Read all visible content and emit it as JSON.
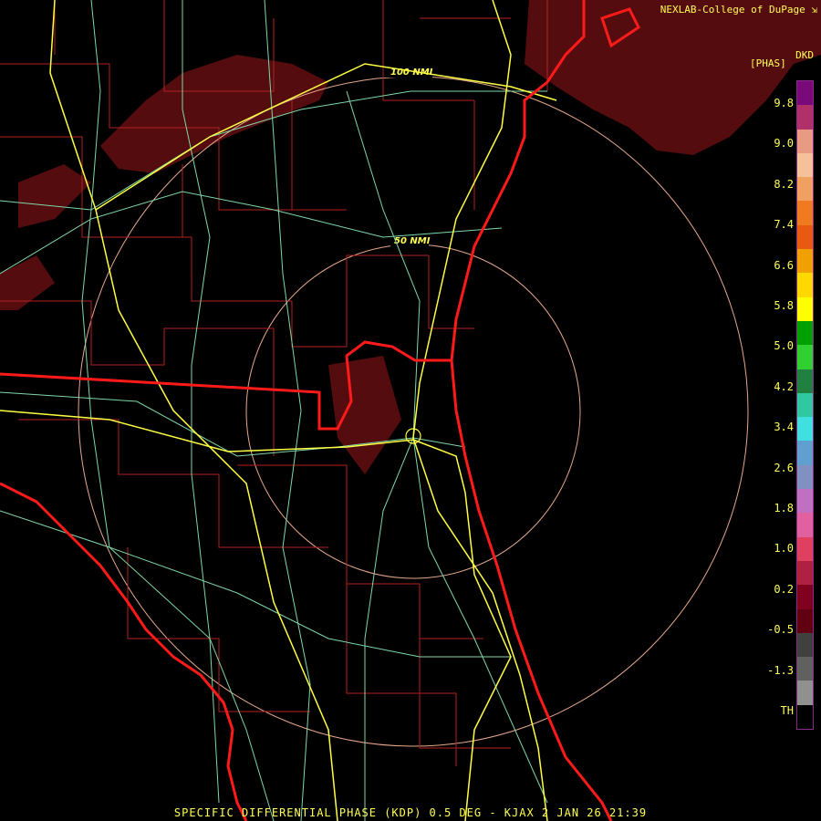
{
  "credit": "NEXLAB-College of DuPage",
  "credit_icon": "external-link-icon",
  "product_code": "DKD",
  "units": "[PHAS]",
  "range_rings": [
    "100 NMI",
    "50 NMI"
  ],
  "legend": {
    "labels": [
      "9.8",
      "9.0",
      "8.2",
      "7.4",
      "6.6",
      "5.8",
      "5.0",
      "4.2",
      "3.4",
      "2.6",
      "1.8",
      "1.0",
      "0.2",
      "-0.5",
      "-1.3",
      "TH"
    ],
    "colors": [
      "#7a0a7a",
      "#b0306a",
      "#e89b82",
      "#f5c19a",
      "#f0a060",
      "#f07a20",
      "#e85a10",
      "#f0a000",
      "#ffd800",
      "#ffff00",
      "#00a000",
      "#30d030",
      "#208040",
      "#30c8a0",
      "#40e0e0",
      "#60a0d0",
      "#8090c0",
      "#c070c0",
      "#e060a0",
      "#e04060",
      "#b02040",
      "#800020",
      "#600010",
      "#404040",
      "#606060",
      "#909090",
      "#000000"
    ]
  },
  "footer": "SPECIFIC DIFFERENTIAL PHASE (KDP) 0.5 DEG - KJAX 2 JAN 26 21:39",
  "colors": {
    "coast": "#ff1a1a",
    "county": "#b02020",
    "highway": "#ffff44",
    "road": "#7fd8a8",
    "ring": "#e6a88c",
    "echo": "#5a0d10"
  }
}
